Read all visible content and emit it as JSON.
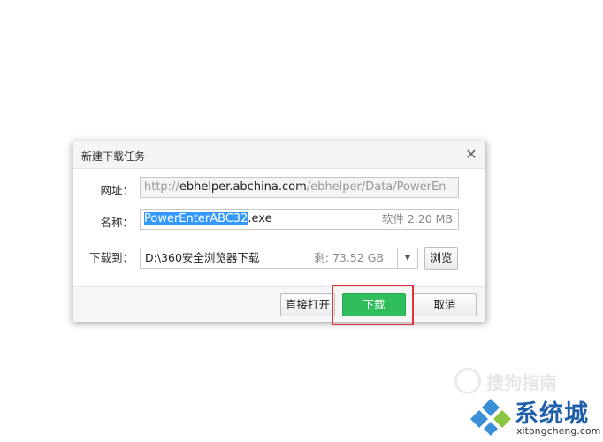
{
  "dialog": {
    "title": "新建下载任务",
    "url_label": "网址：",
    "url_prefix": "http://",
    "url_host": "ebhelper.abchina.com",
    "url_rest": "/ebhelper/Data/PowerEn",
    "name_label": "名称：",
    "name_selected": "PowerEnterABC32",
    "name_ext": ".exe",
    "name_meta": "软件 2.20 MB",
    "save_label": "下载到：",
    "save_path": "D:\\360安全浏览器下载",
    "save_free": "剩: 73.52 GB",
    "browse_label": "浏览",
    "open_label": "直接打开",
    "download_label": "下载",
    "cancel_label": "取消"
  },
  "watermark": {
    "sougou": "搜狗指南",
    "logo_text": "系统城",
    "logo_url": "xitongcheng.com"
  },
  "colors": {
    "primary": "#2fbe5b",
    "highlight": "#e0333a",
    "selection": "#3399ff",
    "logo_blue": "#1f5fa8"
  }
}
